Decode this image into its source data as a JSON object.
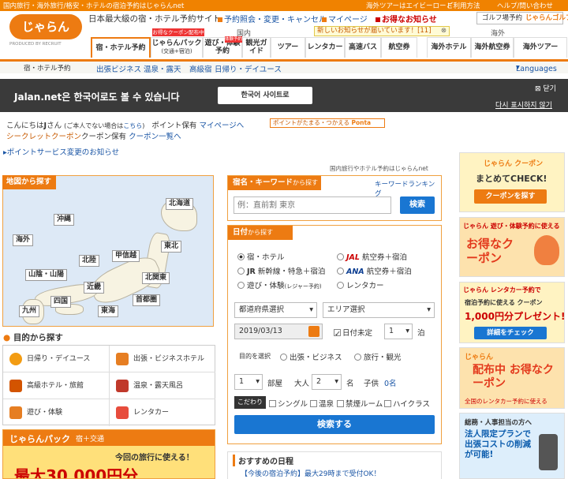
{
  "topbar": {
    "left_text": "国内旅行・海外旅行/格安・ホテルの宿泊予約はじゃらんnet",
    "right_links": [
      "海外ツアーはエイビーロード",
      "ご利用方法",
      "ヘルプ/問い合わせ"
    ]
  },
  "header": {
    "logo_text": "じゃらん",
    "logo_sub": "PRODUCED BY RECRUIT",
    "tagline": "日本最大級の宿・ホテル予約サイト",
    "links": [
      "予約照会・変更・キャンセル",
      "マイページ",
      "お得なお知らせ"
    ],
    "notice": "新しいお知らせが届いています！[11]",
    "golf": "ゴルフ場予約"
  },
  "tabs": {
    "domestic_label": "国内",
    "overseas_label": "海外",
    "coupon_badge": "お得なクーポン配布中",
    "badge_new": "体験予約",
    "items": [
      "宿・ホテル予約",
      "じゃらんパック",
      "遊び・体験予約",
      "観光ガイド",
      "ツアー",
      "レンタカー",
      "高速バス",
      "航空券",
      "海外ホテル",
      "海外航空券",
      "海外ツアー"
    ],
    "pack_sub": "(交通+宿泊)"
  },
  "subnav": {
    "crumb": "宿・ホテル予約",
    "links": [
      "出張ビジネス",
      "温泉・露天",
      "高級宿",
      "日帰り・デイユース"
    ],
    "languages": "Languages"
  },
  "banner": {
    "text": "Jalan.net은 한국어로도 볼 수 있습니다",
    "button": "한국어 사이트로",
    "close": "닫기",
    "hide": "다시 표시하지 않기"
  },
  "greeting": {
    "text": "こんにちは",
    "name": "J",
    "suffix": "さん",
    "not_you": "(ご本人でない場合は",
    "here": "こちら",
    "close_paren": ")",
    "points": "ポイント保有",
    "mypage": "マイページへ",
    "ponta_text": "ポイントがたまる・つかえる",
    "ponta": "Ponta",
    "secret": "シークレットクーポン",
    "coupon_hold": "クーポン保有",
    "coupon_link": "クーポン一覧へ",
    "point_change": "ポイントサービス変更のお知らせ"
  },
  "right_note": "国内旅行やホテル予約はじゃらんnet",
  "map": {
    "title": "地図から探す",
    "regions": [
      "北海道",
      "東北",
      "北関東",
      "首都圏",
      "甲信越",
      "北陸",
      "東海",
      "近畿",
      "山陰・山陽",
      "四国",
      "九州",
      "沖縄",
      "海外"
    ]
  },
  "purpose": {
    "title": "目的から探す",
    "items": [
      "日帰り・デイユース",
      "出張・ビジネスホテル",
      "高級ホテル・旅館",
      "温泉・露天風呂",
      "遊び・体験",
      "レンタカー"
    ]
  },
  "pack_banner": {
    "brand": "じゃらんパック",
    "plus": "宿＋交通",
    "label": "今回の旅行に使える！",
    "amount": "最大30,000円分"
  },
  "search": {
    "kw_title": "宿名・キーワード",
    "kw_sub": "から探す",
    "ranking": "キーワードランキング",
    "placeholder": "例：直前割 東京",
    "search_btn": "検索",
    "date_title": "日付",
    "date_sub": "から探す",
    "options": [
      "宿・ホテル",
      "航空券＋宿泊",
      "新幹線・特急＋宿泊",
      "航空券＋宿泊",
      "遊び・体験",
      "レンタカー"
    ],
    "jal": "JAL",
    "jr": "JR",
    "ana": "ANA",
    "leisure_sub": "(レジャー予約)",
    "pref_select": "都道府県選択",
    "area_select": "エリア選択",
    "date_value": "2019/03/13",
    "date_undecided": "日付未定",
    "nights": "1",
    "nights_unit": "泊",
    "purpose_label": "目的を選択",
    "purpose_opts": [
      "出張・ビジネス",
      "旅行・観光"
    ],
    "rooms": "1",
    "rooms_unit": "部屋",
    "adults_label": "大人",
    "adults": "2",
    "adults_unit": "名",
    "child_label": "子供",
    "child_value": "0名",
    "kodawari": "こだわり",
    "checks": [
      "シングル",
      "温泉",
      "禁煙ルーム",
      "ハイクラス"
    ],
    "submit": "検索する"
  },
  "recommend": {
    "title": "おすすめの日程",
    "item": "【今後の宿泊予約】最大29時まで受付OK！"
  },
  "ads": [
    {
      "brand": "じゃらん クーポン",
      "title": "まとめてCHECK!",
      "button": "クーポンを探す"
    },
    {
      "brand": "じゃらん 遊び・体験予約に使える",
      "title": "お得なクーポン"
    },
    {
      "brand": "じゃらん レンタカー予約で",
      "sub": "宿泊予約に使える クーポン",
      "title": "1,000円分プレゼント!",
      "button": "詳細をチェック"
    },
    {
      "brand": "じゃらん",
      "title": "配布中 お得なクーポン",
      "sub": "全国のレンタカー予約に使える"
    },
    {
      "sub": "総務・人事担当の方へ",
      "title": "法人限定プランで出張コストの削減が可能!"
    }
  ],
  "colors": {
    "orange": "#ed7b12",
    "blue": "#1976d2",
    "dark": "#3a3a3a"
  }
}
